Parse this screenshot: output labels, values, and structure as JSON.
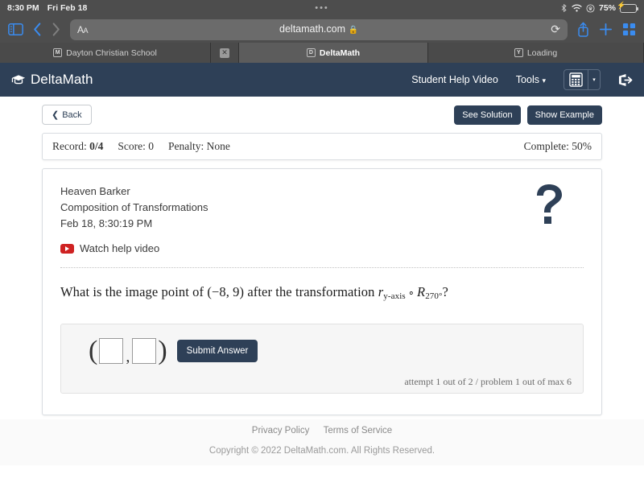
{
  "status_bar": {
    "time": "8:30 PM",
    "date": "Fri Feb 18",
    "center_dots": "•••",
    "battery_percent": "75%",
    "icons": [
      "bluetooth-icon",
      "wifi-icon",
      "orientation-lock-icon",
      "battery-charging-icon"
    ]
  },
  "browser": {
    "toolbar": {
      "sidebar_icon": "sidebar-icon",
      "back_icon": "chevron-left-icon",
      "forward_icon": "chevron-right-icon",
      "text_size_label": "AA",
      "url": "deltamath.com",
      "lock_icon": "lock-icon",
      "reload_icon": "reload-icon",
      "share_icon": "share-icon",
      "new_tab_icon": "plus-icon",
      "tab_overview_icon": "tab-grid-icon"
    },
    "tabs": [
      {
        "favicon_letter": "M",
        "title": "Dayton Christian School",
        "active": false
      },
      {
        "favicon_letter": "D",
        "title": "DeltaMath",
        "active": true
      },
      {
        "favicon_letter": "Y",
        "title": "Loading",
        "active": false
      }
    ],
    "close_tab_icon": "close-icon"
  },
  "app_header": {
    "logo_icon": "graduation-cap-icon",
    "logo_text": "DeltaMath",
    "student_help_video": "Student Help Video",
    "tools_label": "Tools",
    "tools_caret": "▾",
    "calculator_icon": "calculator-icon",
    "calculator_caret": "▾",
    "logout_icon": "logout-icon"
  },
  "actions": {
    "back_label": "Back",
    "back_icon": "chevron-left-icon",
    "see_solution_label": "See Solution",
    "show_example_label": "Show Example"
  },
  "record_bar": {
    "record_label": "Record:",
    "record_value": "0/4",
    "score_label": "Score:",
    "score_value": "0",
    "penalty_label": "Penalty:",
    "penalty_value": "None",
    "complete_label": "Complete:",
    "complete_value": "50%"
  },
  "problem": {
    "student_name": "Heaven Barker",
    "assignment_title": "Composition of Transformations",
    "timestamp": "Feb 18, 8:30:19 PM",
    "help_video_label": "Watch help video",
    "help_video_icon": "youtube-icon",
    "question_icon": "question-mark-icon",
    "question": {
      "lead": "What is the image point of",
      "point": "(−8, 9)",
      "middle": "after the transformation",
      "reflection_symbol": "r",
      "reflection_sub": "y-axis",
      "compose_symbol": "∘",
      "rotation_symbol": "R",
      "rotation_sub": "270°",
      "trailing": "?"
    },
    "answer": {
      "open_paren": "(",
      "comma": ",",
      "close_paren": ")",
      "x_value": "",
      "y_value": "",
      "x_placeholder": "",
      "y_placeholder": "",
      "submit_label": "Submit Answer"
    },
    "attempt_text": "attempt 1 out of 2 / problem 1 out of max 6"
  },
  "footer": {
    "privacy_policy": "Privacy Policy",
    "terms_of_service": "Terms of Service",
    "copyright": "Copyright © 2022 DeltaMath.com. All Rights Reserved."
  },
  "colors": {
    "brand_navy": "#2e4057",
    "chrome_gray": "#4d4d4d",
    "accent_blue": "#3a8cf0",
    "battery_green": "#4cd964",
    "youtube_red": "#cf2222"
  }
}
